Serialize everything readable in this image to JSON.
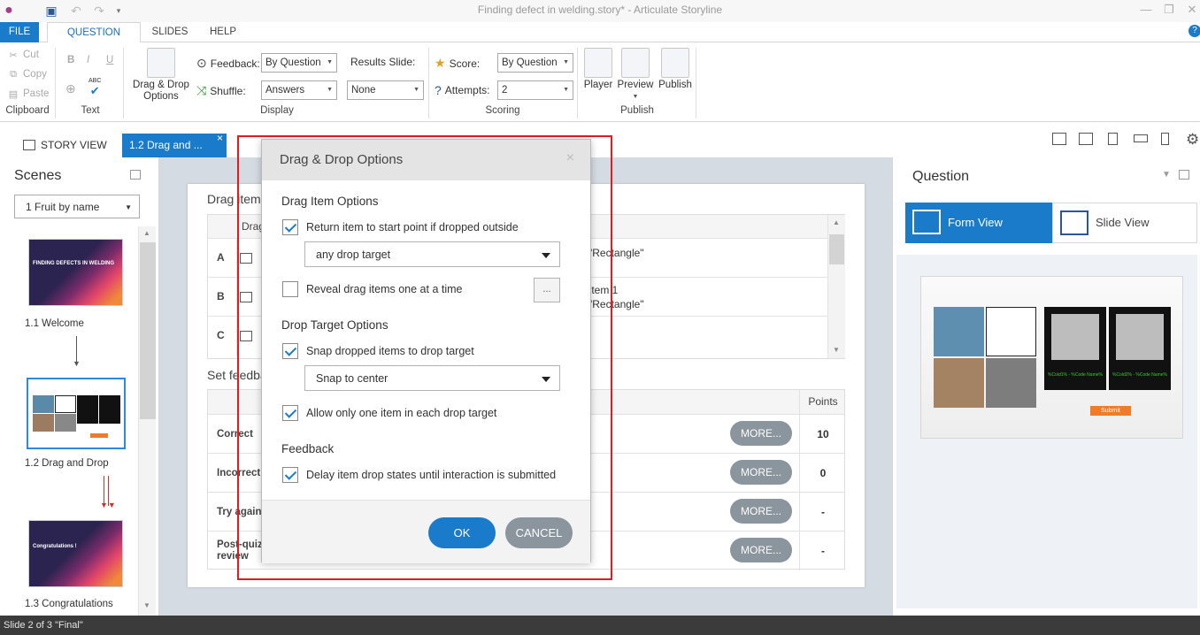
{
  "app": {
    "title": "Finding defect in welding.story* - Articulate Storyline"
  },
  "ribbon_tabs": {
    "file": "FILE",
    "question": "QUESTION",
    "slides": "SLIDES",
    "help": "HELP"
  },
  "clipboard": {
    "cut": "Cut",
    "copy": "Copy",
    "paste": "Paste",
    "label": "Clipboard"
  },
  "text_group": {
    "bold": "B",
    "italic": "I",
    "underline": "U",
    "spell": "ABC",
    "label": "Text"
  },
  "display": {
    "drag_drop_line1": "Drag & Drop",
    "drag_drop_line2": "Options",
    "feedback_label": "Feedback:",
    "feedback_value": "By Question",
    "shuffle_label": "Shuffle:",
    "shuffle_value": "Answers",
    "results_label": "Results Slide:",
    "results_value": "None",
    "label": "Display"
  },
  "scoring": {
    "score_label": "Score:",
    "score_value": "By Question",
    "attempts_label": "Attempts:",
    "attempts_value": "2",
    "label": "Scoring"
  },
  "publish": {
    "player": "Player",
    "preview": "Preview",
    "publish": "Publish",
    "label": "Publish"
  },
  "view_tabs": {
    "story_view": "STORY VIEW",
    "slide_tab": "1.2 Drag and ..."
  },
  "scenes": {
    "title": "Scenes",
    "selector": "1 Fruit by name",
    "slides": [
      {
        "label": "1.1 Welcome",
        "thumb_text": "FINDING DEFECTS IN WELDING"
      },
      {
        "label": "1.2 Drag and Drop"
      },
      {
        "label": "1.3 Congratulations",
        "thumb_text": "Congratulations !"
      }
    ]
  },
  "slide": {
    "drag_items_heading": "Drag item",
    "drag_col": "Drag",
    "rows": [
      {
        "letter": "A",
        "text": "\"Rectangle\""
      },
      {
        "letter": "B",
        "text": "Item 1\n\"Rectangle\""
      },
      {
        "letter": "C",
        "text": ""
      }
    ],
    "feedback_heading": "Set feedba",
    "points_header": "Points",
    "more_label": "MORE...",
    "feedback_rows": [
      {
        "label": "Correct",
        "points": "10"
      },
      {
        "label": "Incorrect",
        "points": "0"
      },
      {
        "label": "Try again",
        "points": "-"
      },
      {
        "label": "Post-quiz review",
        "points": "-"
      }
    ]
  },
  "question_panel": {
    "title": "Question",
    "form_view": "Form View",
    "slide_view": "Slide View",
    "preview_submit": "Submit",
    "preview_cap1": "%Cold1% - %Code Name%",
    "preview_cap2": "%Cold2% - %Code Name%"
  },
  "dialog": {
    "title": "Drag & Drop Options",
    "close": "×",
    "drag_item_options": "Drag Item Options",
    "return_item": "Return item to start point if dropped outside",
    "return_item_checked": true,
    "drop_target_choice": "any drop target",
    "reveal_items": "Reveal drag items one at a time",
    "reveal_items_checked": false,
    "ellipsis": "...",
    "drop_target_options": "Drop Target Options",
    "snap_items": "Snap dropped items to drop target",
    "snap_items_checked": true,
    "snap_choice": "Snap to center",
    "one_item": "Allow only one item in each drop target",
    "one_item_checked": true,
    "feedback_heading": "Feedback",
    "delay_states": "Delay item drop states until interaction is submitted",
    "delay_states_checked": true,
    "ok": "OK",
    "cancel": "CANCEL"
  },
  "status": {
    "text": "Slide 2 of 3   \"Final\""
  },
  "colors": {
    "accent": "#1b7bcb",
    "highlight": "#e01b24",
    "button_gray": "#8a959e"
  }
}
